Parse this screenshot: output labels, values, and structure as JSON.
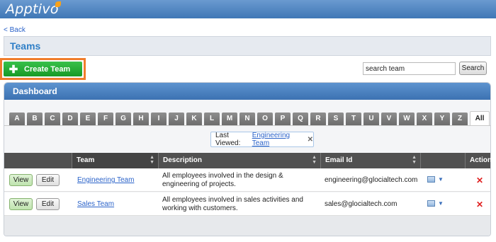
{
  "app": {
    "logo_text": "Apptivo",
    "brand_color": "#4f86c0",
    "accent_color": "#f7a11a"
  },
  "nav": {
    "back_label": "< Back"
  },
  "page": {
    "title": "Teams"
  },
  "toolbar": {
    "create_label": "Create Team",
    "create_icon": "plus-icon",
    "create_color": "#20a830",
    "highlight_color": "#f07d2b",
    "search_value": "search team",
    "search_button_label": "Search"
  },
  "dashboard": {
    "title": "Dashboard",
    "letters": [
      "A",
      "B",
      "C",
      "D",
      "E",
      "F",
      "G",
      "H",
      "I",
      "J",
      "K",
      "L",
      "M",
      "N",
      "O",
      "P",
      "Q",
      "R",
      "S",
      "T",
      "U",
      "V",
      "W",
      "X",
      "Y",
      "Z"
    ],
    "all_label": "All",
    "selected_tab": "All",
    "last_viewed": {
      "label": "Last Viewed:",
      "link": "Engineering Team",
      "close_icon": "close-icon"
    }
  },
  "table": {
    "headers": [
      "",
      "Team",
      "Description",
      "Email Id",
      "",
      "Action"
    ],
    "rows": [
      {
        "view_label": "View",
        "edit_label": "Edit",
        "team": "Engineering Team",
        "description": "All employees involved in the design & engineering of projects.",
        "email": "engineering@glocialtech.com",
        "menu_icon": "card-menu-icon",
        "delete_icon": "delete-x-icon"
      },
      {
        "view_label": "View",
        "edit_label": "Edit",
        "team": "Sales Team",
        "description": "All employees involved in sales activities and working with customers.",
        "email": "sales@glocialtech.com",
        "menu_icon": "card-menu-icon",
        "delete_icon": "delete-x-icon"
      }
    ]
  }
}
